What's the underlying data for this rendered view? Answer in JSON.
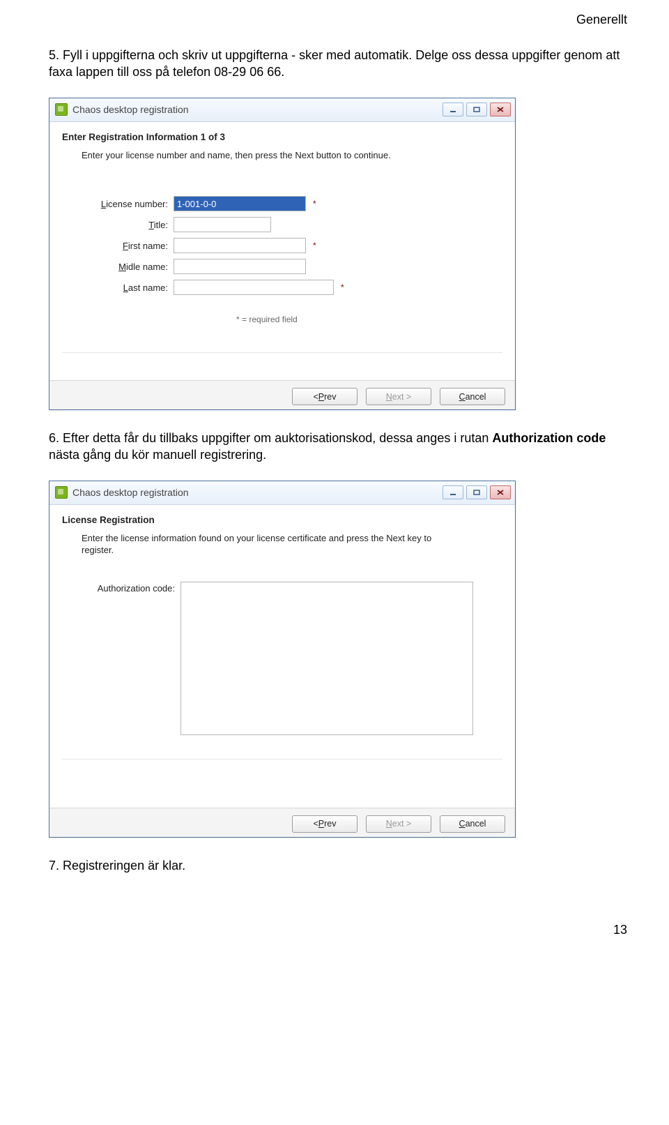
{
  "header": {
    "right": "Generellt"
  },
  "paragraphs": {
    "p5": "5. Fyll i uppgifterna och skriv ut uppgifterna - sker med automatik. Delge oss dessa uppgifter genom att faxa lappen till oss på telefon 08-29 06 66.",
    "p6_pre": "6. Efter detta får du tillbaks uppgifter om auktorisationskod, dessa anges i rutan ",
    "p6_bold": "Authorization code",
    "p6_post": " nästa gång du kör manuell registrering.",
    "p7": "7. Registreringen är klar."
  },
  "dialog1": {
    "title": "Chaos desktop registration",
    "heading": "Enter Registration Information 1 of 3",
    "intro": "Enter your license number and name, then press the Next button to continue.",
    "fields": {
      "license_label_pre": "L",
      "license_label": "icense number:",
      "license_value": "1-001-0-0",
      "title_label_pre": "T",
      "title_label": "itle:",
      "title_value": "",
      "first_label_pre": "F",
      "first_label": "irst name:",
      "first_value": "",
      "midle_label_pre": "M",
      "midle_label": "idle name:",
      "midle_value": "",
      "last_label_pre": "L",
      "last_label": "ast name:",
      "last_value": ""
    },
    "required_note": "*  = required field",
    "buttons": {
      "prev": "< Prev",
      "prev_ul": "P",
      "next": "Next >",
      "next_ul": "N",
      "cancel": "Cancel",
      "cancel_ul": "C"
    }
  },
  "dialog2": {
    "title": "Chaos desktop registration",
    "heading": "License Registration",
    "intro": "Enter the license information found on your license certificate and press the Next key to register.",
    "auth_label_pre": "A",
    "auth_label": "uthorization code:",
    "buttons": {
      "prev": "< Prev",
      "prev_ul": "P",
      "next": "Next >",
      "next_ul": "N",
      "cancel": "Cancel",
      "cancel_ul": "C"
    }
  },
  "page_number": "13"
}
